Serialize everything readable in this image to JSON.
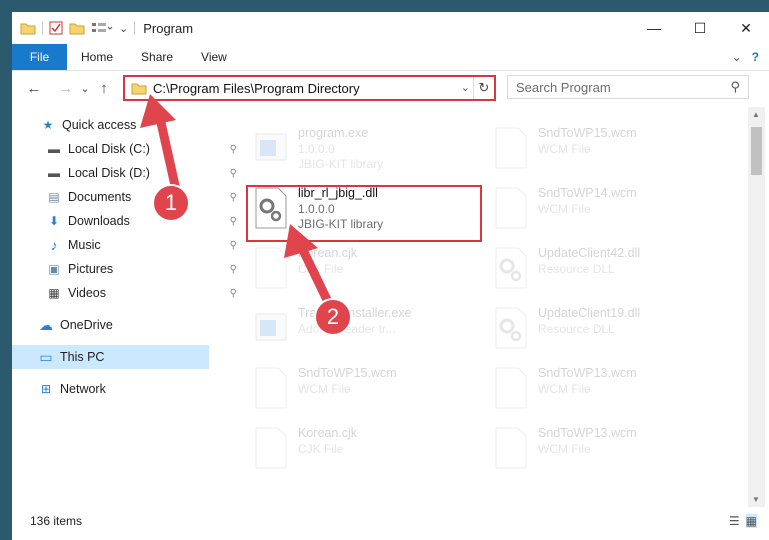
{
  "window": {
    "title": "Program",
    "controls": {
      "minimize": "—",
      "maximize": "☐",
      "close": "✕"
    }
  },
  "ribbon": {
    "file": "File",
    "tabs": [
      "Home",
      "Share",
      "View"
    ],
    "chevron": "⌄",
    "help": "?"
  },
  "nav_buttons": {
    "back": "←",
    "forward": "→",
    "recent": "⌄",
    "up": "↑"
  },
  "address": {
    "path": "C:\\Program Files\\Program Directory",
    "dropdown": "⌄",
    "refresh": "↻"
  },
  "search": {
    "placeholder": "Search Program",
    "icon": "⚲"
  },
  "sidebar": {
    "items": [
      {
        "label": "Quick access",
        "icon": "star-icon",
        "glyph": "★",
        "color": "#2a7fd4"
      },
      {
        "label": "Local Disk (C:)",
        "icon": "drive-icon",
        "glyph": "▬",
        "color": "#555555",
        "pinned": true
      },
      {
        "label": "Local Disk (D:)",
        "icon": "drive-icon",
        "glyph": "▬",
        "color": "#555555",
        "pinned": true
      },
      {
        "label": "Documents",
        "icon": "documents-icon",
        "glyph": "▤",
        "color": "#6a88a8",
        "pinned": true
      },
      {
        "label": "Downloads",
        "icon": "download-icon",
        "glyph": "⬇",
        "color": "#2a7fd4",
        "pinned": true
      },
      {
        "label": "Music",
        "icon": "music-icon",
        "glyph": "♪",
        "color": "#2a7fd4",
        "pinned": true
      },
      {
        "label": "Pictures",
        "icon": "pictures-icon",
        "glyph": "▣",
        "color": "#6a88a8",
        "pinned": true
      },
      {
        "label": "Videos",
        "icon": "videos-icon",
        "glyph": "▦",
        "color": "#444444",
        "pinned": true
      },
      {
        "label": "OneDrive",
        "icon": "cloud-icon",
        "glyph": "☁",
        "color": "#2a7fd4"
      },
      {
        "label": "This PC",
        "icon": "computer-icon",
        "glyph": "▭",
        "color": "#2a7fd4",
        "selected": true
      },
      {
        "label": "Network",
        "icon": "network-icon",
        "glyph": "⊞",
        "color": "#2a7fd4"
      }
    ],
    "pin_glyph": "⚲"
  },
  "files": [
    {
      "name": "program.exe",
      "l2": "1.0.0.0",
      "l3": "JBIG-KIT library",
      "faded": true,
      "icon": "exe-icon"
    },
    {
      "name": "SndToWP15.wcm",
      "l2": "WCM File",
      "l3": "",
      "faded": true,
      "icon": "file-icon"
    },
    {
      "name": "libr_rl_jbig_.dll",
      "l2": "1.0.0.0",
      "l3": "JBIG-KIT library",
      "faded": false,
      "icon": "dll-gear-icon"
    },
    {
      "name": "SndToWP14.wcm",
      "l2": "WCM File",
      "l3": "",
      "faded": true,
      "icon": "file-icon"
    },
    {
      "name": "Korean.cjk",
      "l2": "CJK File",
      "l3": "",
      "faded": true,
      "icon": "file-icon"
    },
    {
      "name": "UpdateClient42.dll",
      "l2": "Resource DLL",
      "l3": "",
      "faded": true,
      "icon": "dll-gear-icon"
    },
    {
      "name": "TrayAppInstaller.exe",
      "l2": "Adobe Reader tr...",
      "l3": "",
      "faded": true,
      "icon": "exe-icon"
    },
    {
      "name": "UpdateClient19.dll",
      "l2": "Resource DLL",
      "l3": "",
      "faded": true,
      "icon": "dll-gear-icon"
    },
    {
      "name": "SndToWP15.wcm",
      "l2": "WCM File",
      "l3": "",
      "faded": true,
      "icon": "file-icon"
    },
    {
      "name": "SndToWP13.wcm",
      "l2": "WCM File",
      "l3": "",
      "faded": true,
      "icon": "file-icon"
    },
    {
      "name": "Korean.cjk",
      "l2": "CJK File",
      "l3": "",
      "faded": true,
      "icon": "file-icon"
    },
    {
      "name": "SndToWP13.wcm",
      "l2": "WCM File",
      "l3": "",
      "faded": true,
      "icon": "file-icon"
    }
  ],
  "status": {
    "count": "136 items",
    "details_view": "☰",
    "tiles_view": "▦"
  },
  "callouts": [
    {
      "label": "1"
    },
    {
      "label": "2"
    }
  ],
  "colors": {
    "accent": "#1979ca",
    "highlight": "#d9363e",
    "selected": "#cce8ff"
  }
}
